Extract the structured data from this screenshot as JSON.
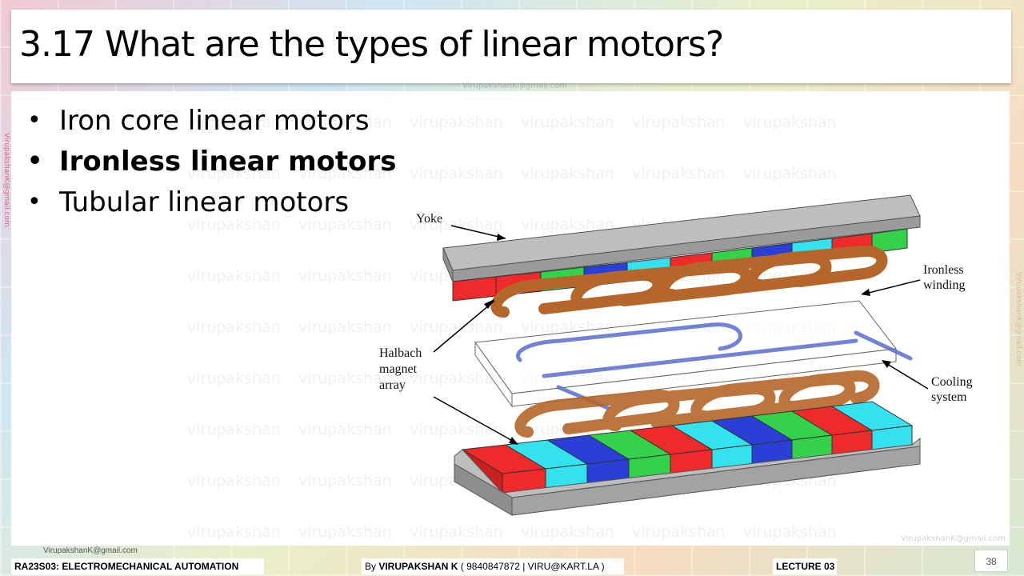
{
  "slide": {
    "title": "3.17 What are the types of linear motors?",
    "bullets": [
      {
        "text": "Iron core linear motors",
        "bold": false
      },
      {
        "text": "Ironless linear motors",
        "bold": true
      },
      {
        "text": "Tubular linear motors",
        "bold": false
      }
    ],
    "watermark_text": "virupakshan",
    "top_email": "VirupakshanK@gmail.com",
    "side_email": "VirupakshanK@gmail.com",
    "side_email_right": "VirupakshanK@gmail.com",
    "bottom_right_email": "VirupakshanK@gmail.com"
  },
  "diagram": {
    "labels": {
      "yoke": "Yoke",
      "ironless_winding_1": "Ironless",
      "ironless_winding_2": "winding",
      "halbach_1": "Halbach",
      "halbach_2": "magnet",
      "halbach_3": "array",
      "cooling_1": "Cooling",
      "cooling_2": "system"
    },
    "colors": {
      "yoke": "#a9abab",
      "magnet_red": "#ee2a2a",
      "magnet_green": "#33d24a",
      "magnet_blue": "#2a3fd6",
      "magnet_cyan": "#33e2ee",
      "winding": "#b5672b"
    }
  },
  "footer": {
    "email": "VirupakshanK@gmail.com",
    "course": "RA23S03:   ELECTROMECHANICAL AUTOMATION",
    "author_prefix": "By ",
    "author_name": "VIRUPAKSHAN K",
    "author_contact": " ( 9840847872 | VIRU@KART.LA )",
    "lecture": "LECTURE 03",
    "page_number": "38"
  }
}
